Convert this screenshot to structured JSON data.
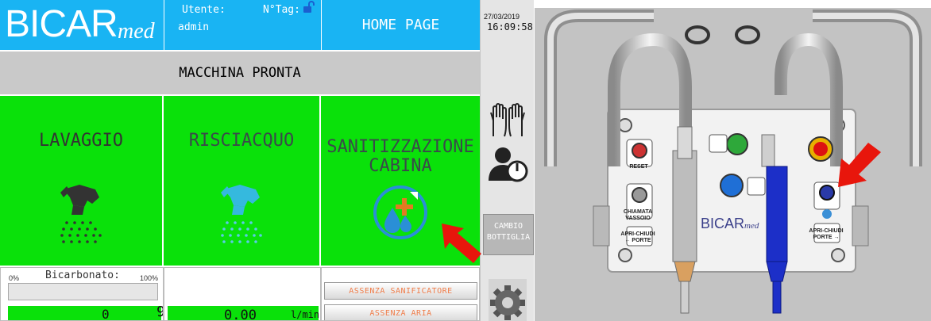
{
  "header": {
    "logo_main": "BICAR",
    "logo_sub": "med",
    "user_label": "Utente:",
    "user_value": "admin",
    "tag_label": "N°Tag:",
    "home_label": "HOME PAGE"
  },
  "status_text": "MACCHINA PRONTA",
  "programs": {
    "lavaggio": "LAVAGGIO",
    "risciacquo": "RISCIACQUO",
    "sanitizzazione_line1": "SANITIZZAZIONE",
    "sanitizzazione_line2": "CABINA"
  },
  "bicarbonato": {
    "label": "Bicarbonato:",
    "min_label": "0%",
    "max_label": "100%",
    "level_fraction": 0.0,
    "counter_value": "0",
    "counter_value2": "9"
  },
  "flow": {
    "value": "0.00",
    "unit": "l/min"
  },
  "alarms": [
    "ASSENZA SANIFICATORE",
    "ASSENZA ARIA"
  ],
  "side": {
    "date": "27/03/2019",
    "time": "16:09:58",
    "cambio_line1": "CAMBIO",
    "cambio_line2": "BOTTIGLIA"
  },
  "photo_panel": {
    "reset_label": "RESET",
    "chiamata_line1": "CHIAMATA",
    "chiamata_line2": "VASSOIO",
    "apri_left_line1": "APRI-CHIUDI",
    "apri_left_line2": "← PORTE",
    "apri_right_line1": "APRI-CHIUDI",
    "apri_right_line2": "PORTE →",
    "brand_main": "BICAR",
    "brand_sub": "med"
  },
  "colors": {
    "header_blue": "#19b4f3",
    "ready_green": "#0ae10a",
    "status_gray": "#c9c9c9",
    "alarm_text": "#f07d4a",
    "arrow_red": "#e8160c"
  }
}
